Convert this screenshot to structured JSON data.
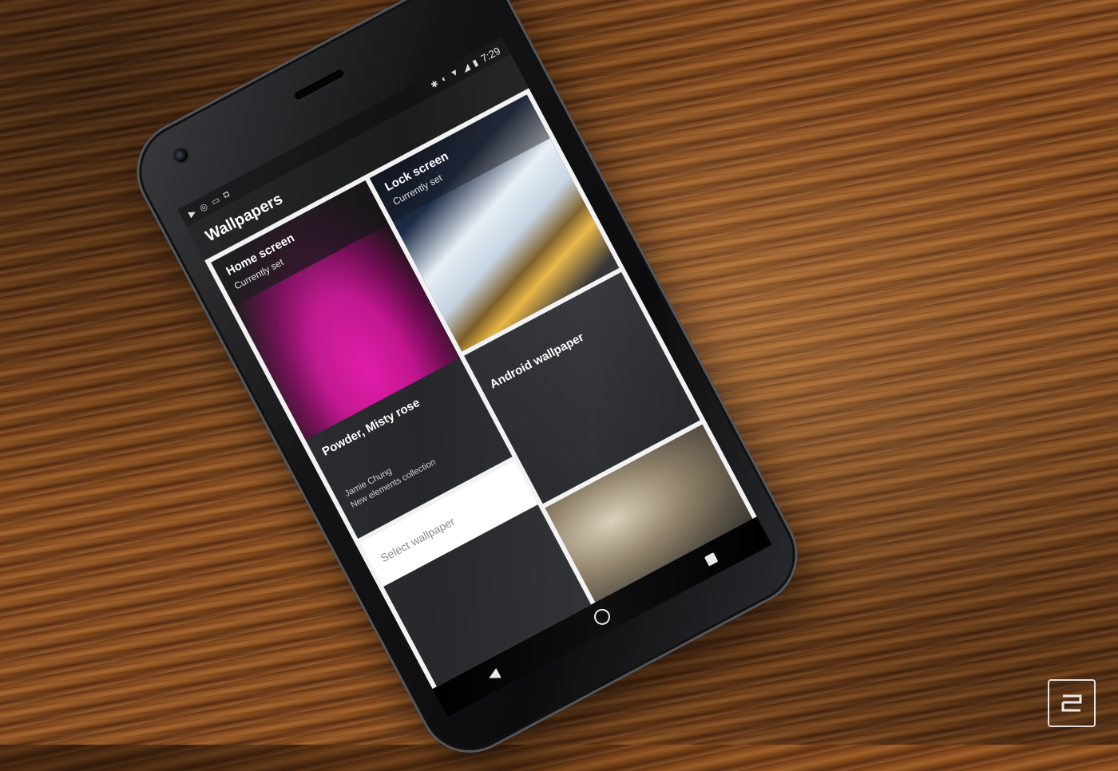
{
  "status_bar": {
    "time": "7:29",
    "left_icons": [
      "youtube-icon",
      "instagram-icon",
      "inbox-icon",
      "bag-icon"
    ],
    "right_icons": [
      "bluetooth-icon",
      "data-saver-icon",
      "wifi-icon",
      "signal-icon",
      "battery-icon"
    ]
  },
  "app_bar": {
    "title": "Wallpapers"
  },
  "tiles": {
    "home": {
      "title": "Home screen",
      "subtitle": "Currently set"
    },
    "lock": {
      "title": "Lock screen",
      "subtitle": "Currently set"
    },
    "current_wallpaper": {
      "title": "Powder, Misty rose",
      "author": "Jamie Chung",
      "collection": "New elements collection"
    },
    "android": {
      "title": "Android wallpaper"
    },
    "select": {
      "label": "Select wallpaper"
    }
  },
  "nav_bar": {
    "items": [
      "back-icon",
      "home-icon",
      "recents-icon"
    ]
  },
  "colors": {
    "accent_pink": "#e01aa8",
    "screen_bg": "#202124",
    "wood": "#8a4d1f"
  },
  "watermark": {
    "name": "engadget-logo"
  }
}
